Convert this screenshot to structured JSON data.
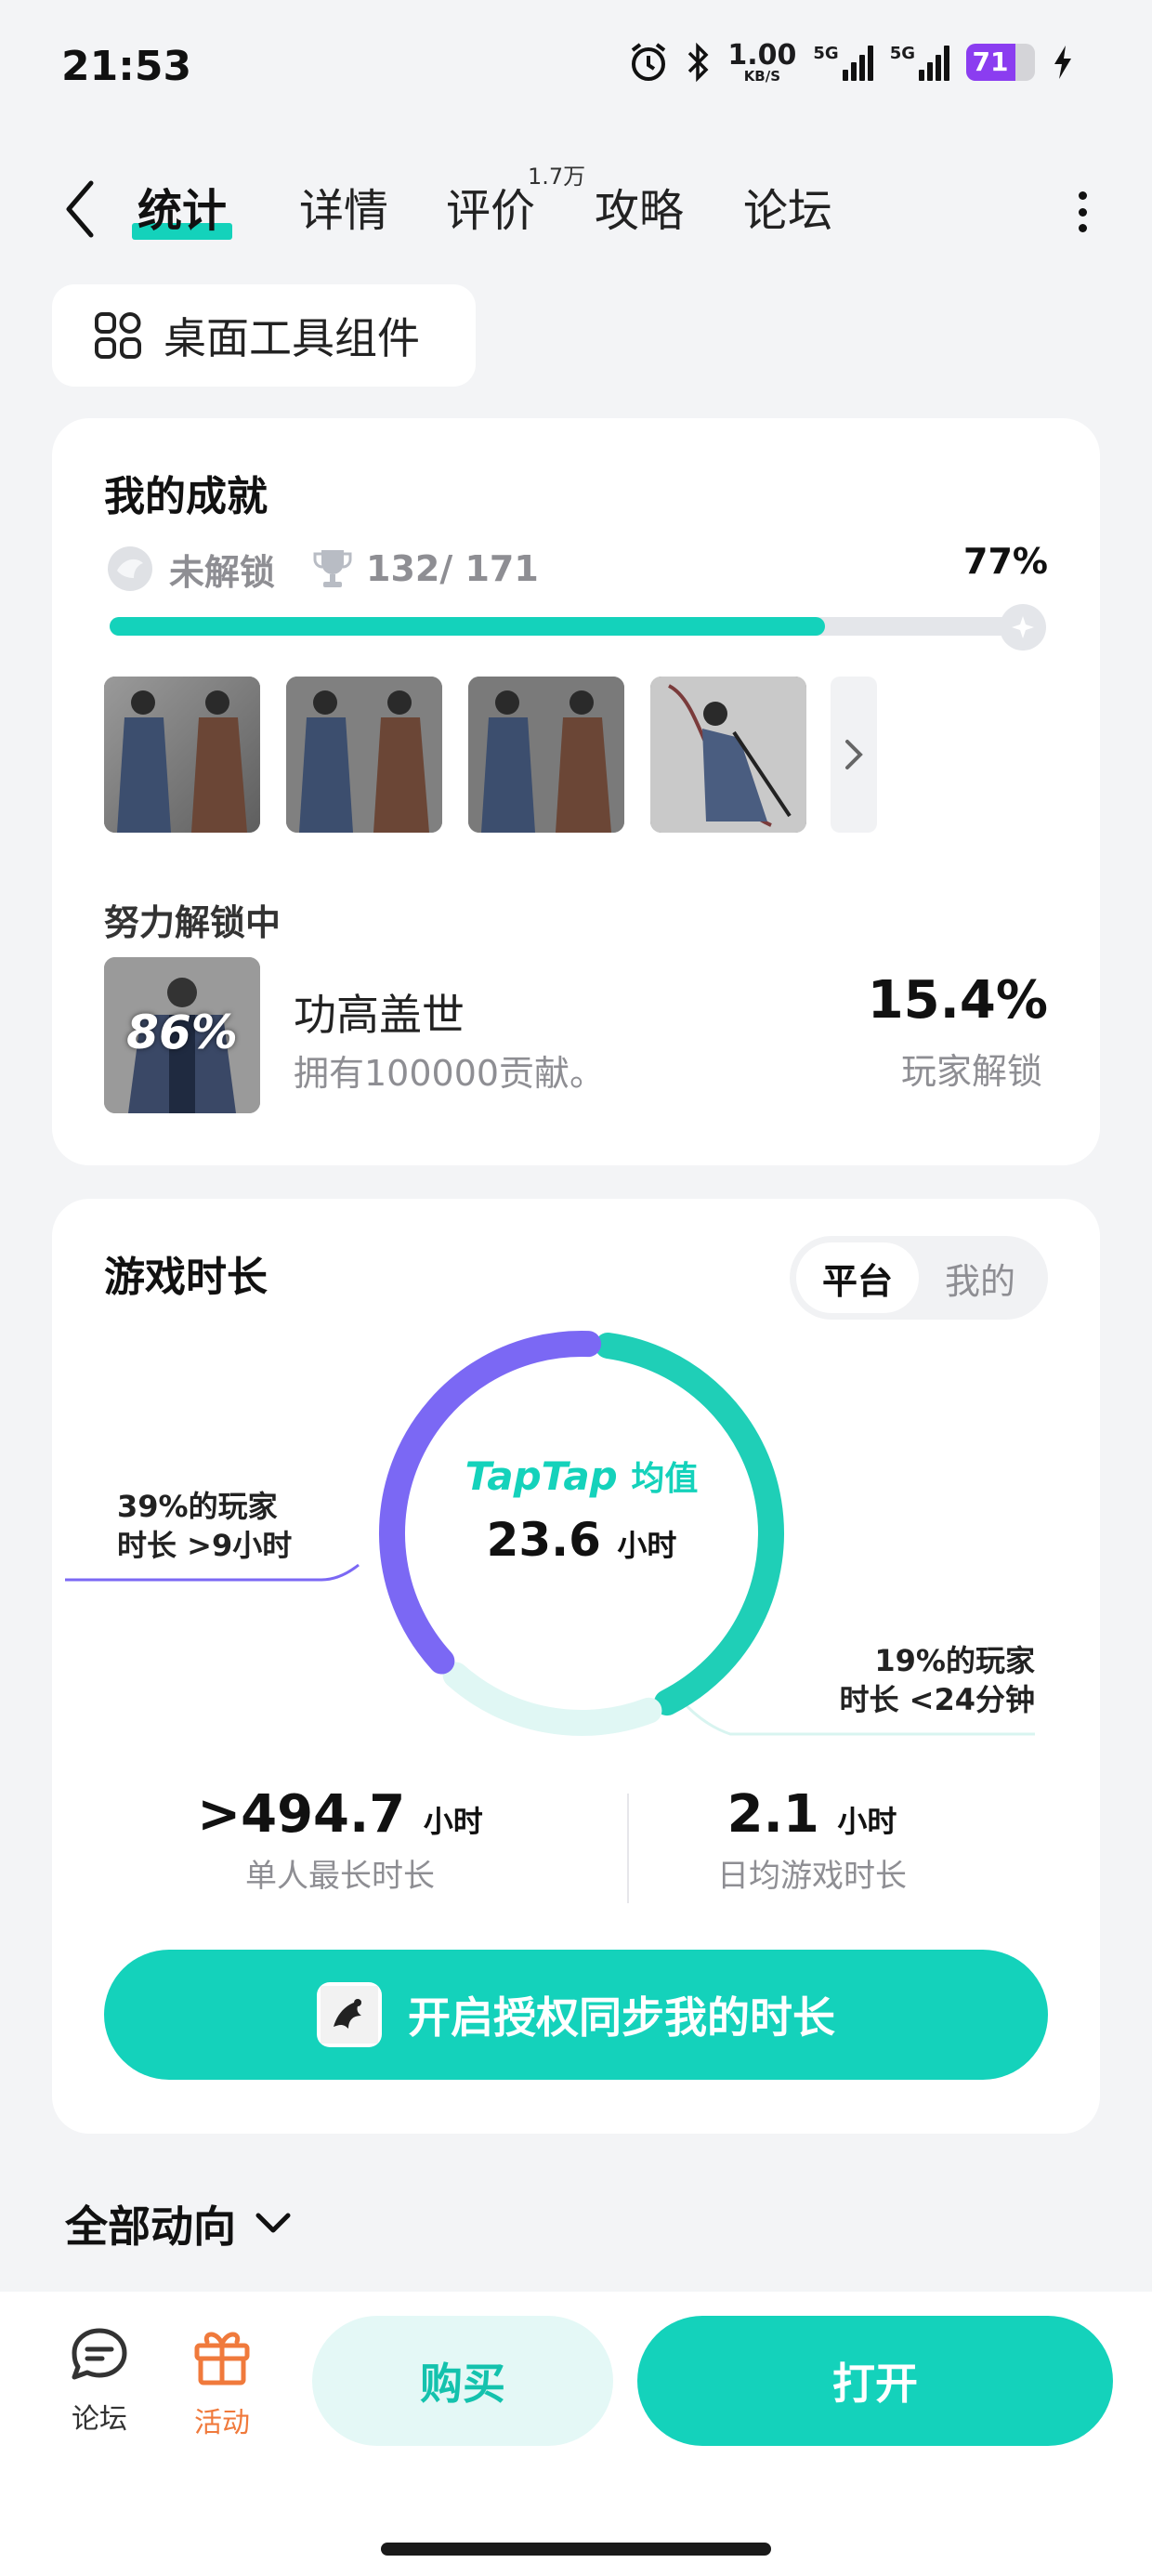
{
  "status_bar": {
    "time": "21:53",
    "speed_value": "1.00",
    "speed_unit": "KB/S",
    "sim1_label": "5G",
    "sim2_label": "5G",
    "battery_level": "71"
  },
  "nav": {
    "tabs": [
      {
        "label": "统计"
      },
      {
        "label": "详情"
      },
      {
        "label": "评价"
      },
      {
        "label": "攻略"
      },
      {
        "label": "论坛"
      }
    ],
    "review_count_badge": "1.7万"
  },
  "widget_button": {
    "label": "桌面工具组件",
    "icon": "grid-icon"
  },
  "achievements": {
    "title": "我的成就",
    "locked_label": "未解锁",
    "count_label": "132/ 171",
    "percent_label": "77%",
    "progress_fraction": 0.77,
    "in_progress_title": "努力解锁中",
    "in_progress": {
      "thumb_percent": "86%",
      "name": "功高盖世",
      "desc": "拥有100000贡献。",
      "rate": "15.4%",
      "rate_label": "玩家解锁"
    }
  },
  "playtime": {
    "title": "游戏时长",
    "segment": {
      "options": [
        "平台",
        "我的"
      ],
      "selected": "平台"
    },
    "brand": "TapTap",
    "avg_label": "均值",
    "avg_value": "23.6",
    "avg_unit": "小时",
    "left_note_line1": "39%的玩家",
    "left_note_line2": "时长 >9小时",
    "right_note_line1": "19%的玩家",
    "right_note_line2": "时长 <24分钟",
    "ring_segments": [
      {
        "share": 0.42,
        "color": "#1fcfb7"
      },
      {
        "share": 0.19,
        "color": "#e0f7f4"
      },
      {
        "share": 0.39,
        "color": "#7b68f4"
      }
    ],
    "max_value": ">494.7",
    "max_unit": "小时",
    "max_label": "单人最长时长",
    "daily_value": "2.1",
    "daily_unit": "小时",
    "daily_label": "日均游戏时长",
    "sync_button": "开启授权同步我的时长"
  },
  "all_trends": "全部动向",
  "bottom_bar": {
    "forum_label": "论坛",
    "activity_label": "活动",
    "buy_label": "购买",
    "open_label": "打开"
  },
  "colors": {
    "accent": "#14d2bb",
    "purple": "#7b68f4",
    "activity_orange": "#f07a3c",
    "battery": "#8b3df0"
  }
}
